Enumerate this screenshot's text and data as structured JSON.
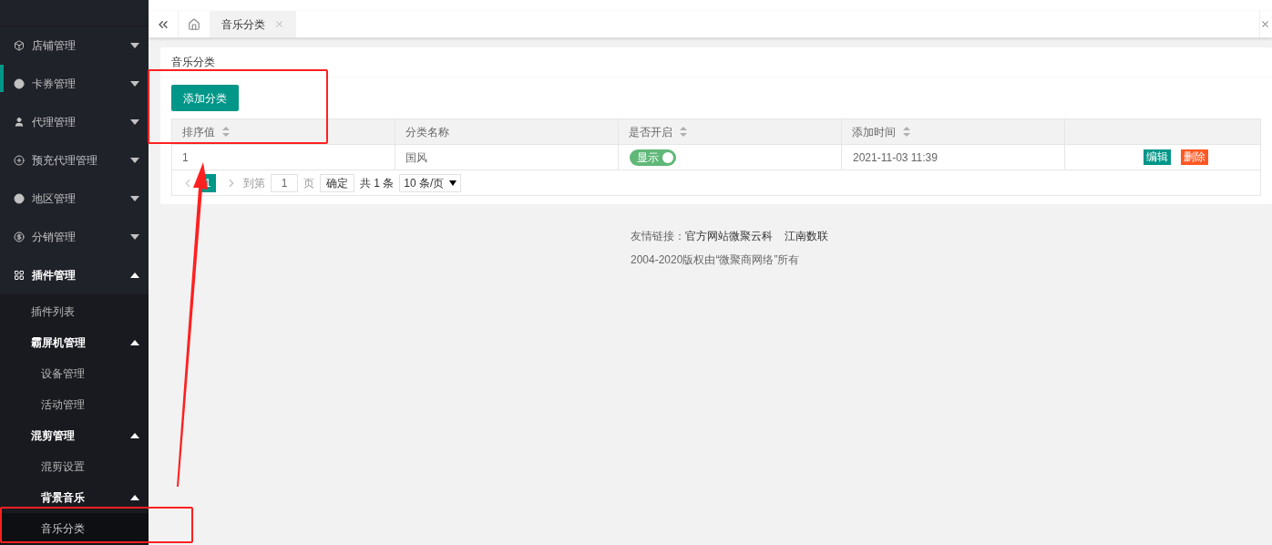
{
  "sidebar": {
    "items": [
      {
        "label": "店铺管理",
        "expanded": false,
        "selected": false
      },
      {
        "label": "卡券管理",
        "expanded": false,
        "selected": true
      },
      {
        "label": "代理管理",
        "expanded": false,
        "selected": false
      },
      {
        "label": "预充代理管理",
        "expanded": false,
        "selected": false
      },
      {
        "label": "地区管理",
        "expanded": false,
        "selected": false
      },
      {
        "label": "分销管理",
        "expanded": false,
        "selected": false
      },
      {
        "label": "插件管理",
        "expanded": true,
        "selected": false,
        "children": [
          {
            "label": "插件列表",
            "selected": false
          },
          {
            "label": "霸屏机管理",
            "expanded": true,
            "children": [
              {
                "label": "设备管理",
                "selected": false
              },
              {
                "label": "活动管理",
                "selected": false
              }
            ]
          },
          {
            "label": "混剪管理",
            "expanded": true,
            "children": [
              {
                "label": "混剪设置",
                "selected": false
              },
              {
                "label": "背景音乐",
                "expanded": true,
                "children": [
                  {
                    "label": "音乐分类",
                    "selected": true
                  }
                ]
              }
            ]
          }
        ]
      }
    ]
  },
  "tabs": [
    {
      "label": "音乐分类",
      "selected": true
    }
  ],
  "card": {
    "title": "音乐分类",
    "add_button": "添加分类",
    "table": {
      "columns": [
        {
          "label": "排序值",
          "sortable": true
        },
        {
          "label": "分类名称",
          "sortable": false
        },
        {
          "label": "是否开启",
          "sortable": true
        },
        {
          "label": "添加时间",
          "sortable": true
        }
      ],
      "rows": [
        {
          "sort": "1",
          "name": "国风",
          "toggle": {
            "label": "显示",
            "on": true
          },
          "time": "2021-11-03 11:39",
          "actions": [
            "编辑",
            "删除"
          ]
        }
      ]
    },
    "pagination": {
      "pages": [
        {
          "label": "1",
          "selected": true
        }
      ],
      "goto_label": "到第",
      "goto_value": "1",
      "page_unit": "页",
      "confirm": "确定",
      "total": "共 1 条",
      "page_size": "10 条/页"
    }
  },
  "footer": {
    "links_label": "友情链接：",
    "links": [
      "官方网站微聚云科",
      "江南数联"
    ],
    "copyright": "2004-2020版权由“微聚商网络”所有"
  }
}
